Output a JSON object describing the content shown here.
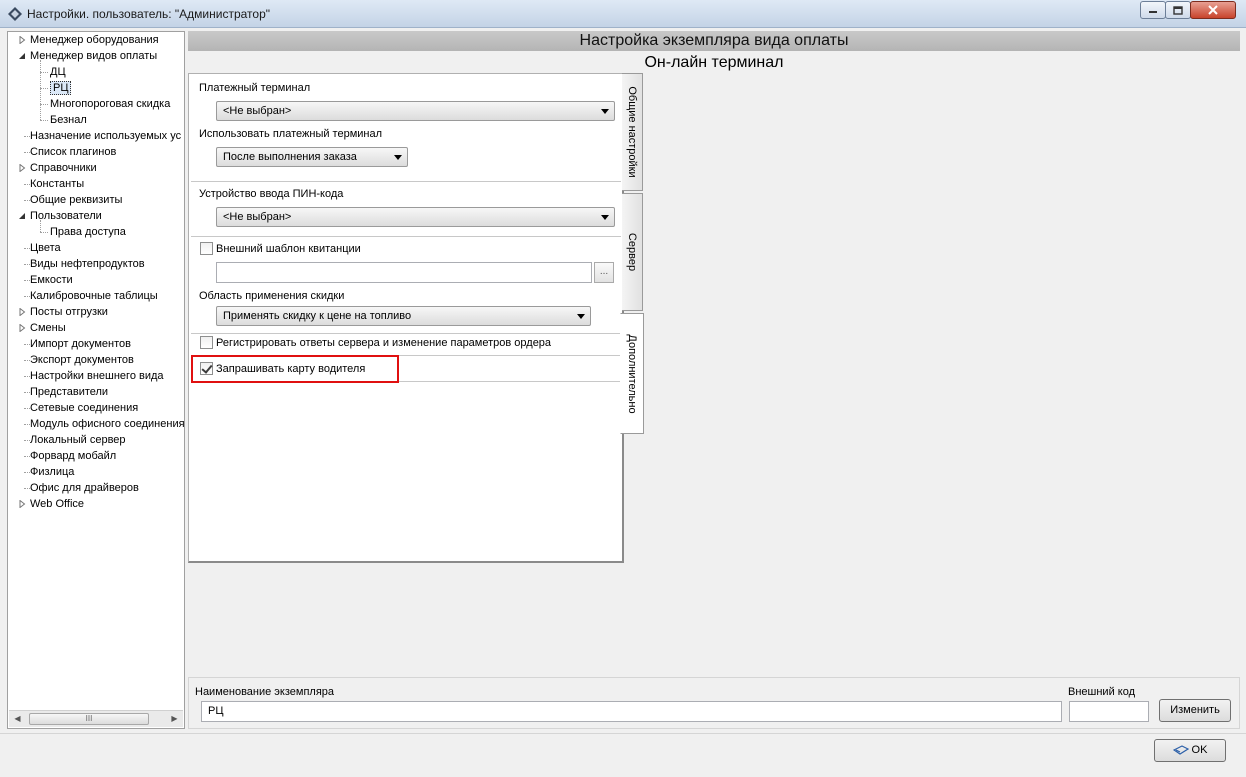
{
  "window": {
    "title": "Настройки. пользователь: \"Администратор\""
  },
  "tree": {
    "items": [
      {
        "label": "Менеджер оборудования",
        "arrow": "collapsed"
      },
      {
        "label": "Менеджер видов оплаты",
        "arrow": "expanded"
      },
      {
        "label": "ДЦ",
        "arrow": "none"
      },
      {
        "label": "РЦ",
        "arrow": "none",
        "selected": true
      },
      {
        "label": "Многопороговая скидка",
        "arrow": "none"
      },
      {
        "label": "Безнал",
        "arrow": "none"
      },
      {
        "label": "Назначение используемых ус",
        "arrow": "none"
      },
      {
        "label": "Список плагинов",
        "arrow": "none"
      },
      {
        "label": "Справочники",
        "arrow": "collapsed"
      },
      {
        "label": "Константы",
        "arrow": "none"
      },
      {
        "label": "Общие реквизиты",
        "arrow": "none"
      },
      {
        "label": "Пользователи",
        "arrow": "expanded"
      },
      {
        "label": "Права доступа",
        "arrow": "none"
      },
      {
        "label": "Цвета",
        "arrow": "none"
      },
      {
        "label": "Виды нефтепродуктов",
        "arrow": "none"
      },
      {
        "label": "Емкости",
        "arrow": "none"
      },
      {
        "label": "Калибровочные таблицы",
        "arrow": "none"
      },
      {
        "label": "Посты отгрузки",
        "arrow": "collapsed"
      },
      {
        "label": "Смены",
        "arrow": "collapsed"
      },
      {
        "label": "Импорт документов",
        "arrow": "none"
      },
      {
        "label": "Экспорт документов",
        "arrow": "none"
      },
      {
        "label": "Настройки внешнего вида",
        "arrow": "none"
      },
      {
        "label": "Представители",
        "arrow": "none"
      },
      {
        "label": "Сетевые соединения",
        "arrow": "none"
      },
      {
        "label": "Модуль офисного соединения",
        "arrow": "none"
      },
      {
        "label": "Локальный сервер",
        "arrow": "none"
      },
      {
        "label": "Форвард мобайл",
        "arrow": "none"
      },
      {
        "label": "Физлица",
        "arrow": "none"
      },
      {
        "label": "Офис для драйверов",
        "arrow": "none"
      },
      {
        "label": "Web Office",
        "arrow": "collapsed"
      }
    ],
    "scroll_thumb": "III"
  },
  "header": {
    "title": "Настройка экземпляра вида оплаты",
    "subtitle": "Он-лайн терминал"
  },
  "form": {
    "payment_terminal_label": "Платежный терминал",
    "payment_terminal_value": "<Не выбран>",
    "use_terminal_label": "Использовать платежный терминал",
    "use_terminal_value": "После выполнения заказа",
    "pin_device_label": "Устройство ввода ПИН-кода",
    "pin_device_value": "<Не выбран>",
    "receipt_template_label": "Внешний шаблон квитанции",
    "receipt_template_checked": false,
    "receipt_template_path": "",
    "browse_label": "...",
    "discount_area_label": "Область применения скидки",
    "discount_area_value": "Применять скидку к цене на топливо",
    "register_responses_label": "Регистрировать ответы сервера и изменение параметров ордера",
    "register_responses_checked": false,
    "request_driver_card_label": "Запрашивать карту водителя",
    "request_driver_card_checked": true
  },
  "tabs": [
    {
      "label": "Общие настройки"
    },
    {
      "label": "Сервер"
    },
    {
      "label": "Дополнительно",
      "active": true
    }
  ],
  "bottom": {
    "instance_name_label": "Наименование экземпляра",
    "instance_name_value": "РЦ",
    "external_code_label": "Внешний код",
    "external_code_value": "",
    "change_button": "Изменить",
    "ok_button": "OK"
  },
  "colors": {
    "highlight": "#e01010",
    "header_bg": "#bcbcbc",
    "selection": "#dbe8f7"
  }
}
